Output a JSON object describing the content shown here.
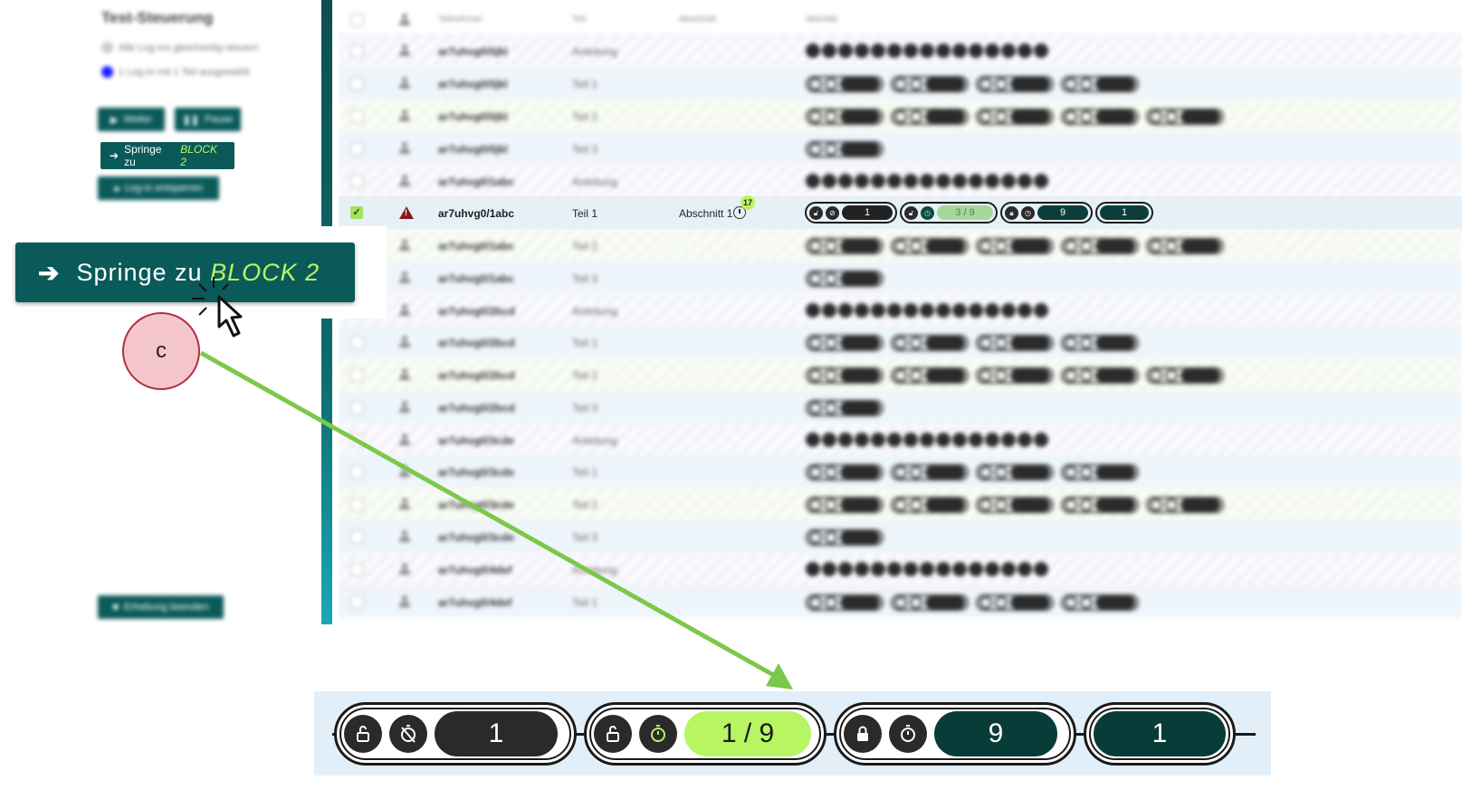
{
  "sidebar": {
    "title": "Test-Steuerung",
    "line1": "Alle Log-ins gleichzeitig steuern",
    "line2": "1 Log-in mit 1 Teil ausgewählt",
    "btn_weiter": "Weiter",
    "btn_pause": "Pause",
    "jump_prefix": "Springe zu",
    "jump_target": "BLOCK 2",
    "btn_unlock": "Log-in entsperren",
    "btn_end": "Erhebung beenden"
  },
  "table": {
    "headers": {
      "participant": "Teilnehmer",
      "part": "Teil",
      "section": "Abschnitt",
      "activity": "Aktivität"
    },
    "selected_row": {
      "login": "ar7uhvg0/1abc",
      "part": "Teil 1",
      "section": "Abschnitt 1",
      "badge": "17",
      "blocks": [
        {
          "value": "1"
        },
        {
          "value": "3 / 9"
        },
        {
          "value": "9"
        },
        {
          "value": "1"
        }
      ]
    },
    "blurred_rows": [
      {
        "login": "ar7uhvg0/0jkl",
        "part": "Anleitung"
      },
      {
        "login": "ar7uhvg0/0jkl",
        "part": "Teil 1"
      },
      {
        "login": "ar7uhvg0/0jkl",
        "part": "Teil 2"
      },
      {
        "login": "ar7uhvg0/0jkl",
        "part": "Teil 3"
      },
      {
        "login": "ar7uhvg0/1abc",
        "part": "Anleitung"
      },
      {
        "login": "ar7uhvg0/1abc",
        "part": "Teil 2"
      },
      {
        "login": "ar7uhvg0/1abc",
        "part": "Teil 3"
      },
      {
        "login": "ar7uhvg0/2bcd",
        "part": "Anleitung"
      },
      {
        "login": "ar7uhvg0/2bcd",
        "part": "Teil 1"
      },
      {
        "login": "ar7uhvg0/2bcd",
        "part": "Teil 2"
      },
      {
        "login": "ar7uhvg0/2bcd",
        "part": "Teil 3"
      },
      {
        "login": "ar7uhvg0/3cde",
        "part": "Anleitung"
      },
      {
        "login": "ar7uhvg0/3cde",
        "part": "Teil 1"
      },
      {
        "login": "ar7uhvg0/3cde",
        "part": "Teil 2"
      },
      {
        "login": "ar7uhvg0/3cde",
        "part": "Teil 3"
      },
      {
        "login": "ar7uhvg0/4def",
        "part": "Anleitung"
      },
      {
        "login": "ar7uhvg0/4def",
        "part": "Teil 1"
      }
    ]
  },
  "callout": {
    "jump_prefix": "Springe zu",
    "jump_target": "BLOCK 2",
    "marker_label": "c"
  },
  "zoom_bar": {
    "blocks": [
      {
        "value": "1",
        "icons": [
          "lock-open-icon",
          "timer-off-icon"
        ]
      },
      {
        "value": "1 / 9",
        "icons": [
          "lock-open-icon",
          "timer-icon"
        ]
      },
      {
        "value": "9",
        "icons": [
          "lock-closed-icon",
          "timer-icon"
        ]
      },
      {
        "value": "1",
        "icons": []
      }
    ]
  },
  "colors": {
    "teal": "#0b5a5a",
    "lime": "#b8f562",
    "arrow_green": "#7cc84a",
    "marker_fill": "#f4c6cc"
  }
}
